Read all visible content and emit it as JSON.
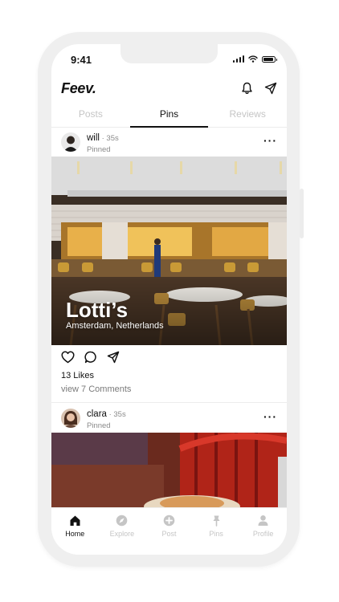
{
  "status_bar": {
    "time": "9:41"
  },
  "header": {
    "logo": "Feev."
  },
  "tabs": [
    {
      "label": "Posts",
      "active": false
    },
    {
      "label": "Pins",
      "active": true
    },
    {
      "label": "Reviews",
      "active": false
    }
  ],
  "posts": [
    {
      "username": "will",
      "time": " · 35s",
      "pinned_label": "Pinned",
      "image_title": "Lotti’s",
      "image_subtitle": "Amsterdam, Netherlands",
      "likes": "13 Likes",
      "comments": "view 7 Comments"
    },
    {
      "username": "clara",
      "time": " · 35s",
      "pinned_label": "Pinned"
    }
  ],
  "bottom_nav": [
    {
      "label": "Home",
      "icon": "home-icon",
      "active": true
    },
    {
      "label": "Explore",
      "icon": "compass-icon",
      "active": false
    },
    {
      "label": "Post",
      "icon": "plus-circle-icon",
      "active": false
    },
    {
      "label": "Pins",
      "icon": "pin-icon",
      "active": false
    },
    {
      "label": "Profile",
      "icon": "person-icon",
      "active": false
    }
  ],
  "colors": {
    "active": "#111111",
    "inactive": "#c5c5c5",
    "frame": "#efefef"
  }
}
